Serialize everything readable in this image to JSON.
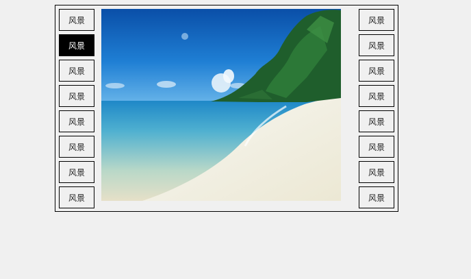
{
  "gallery": {
    "left_thumbs": [
      {
        "label": "风景",
        "active": false
      },
      {
        "label": "风景",
        "active": true
      },
      {
        "label": "风景",
        "active": false
      },
      {
        "label": "风景",
        "active": false
      },
      {
        "label": "风景",
        "active": false
      },
      {
        "label": "风景",
        "active": false
      },
      {
        "label": "风景",
        "active": false
      },
      {
        "label": "风景",
        "active": false
      }
    ],
    "right_thumbs": [
      {
        "label": "风景",
        "active": false
      },
      {
        "label": "风景",
        "active": false
      },
      {
        "label": "风景",
        "active": false
      },
      {
        "label": "风景",
        "active": false
      },
      {
        "label": "风景",
        "active": false
      },
      {
        "label": "风景",
        "active": false
      },
      {
        "label": "风景",
        "active": false
      },
      {
        "label": "风景",
        "active": false
      }
    ],
    "main_image": "tropical-beach-photo"
  },
  "colors": {
    "active_bg": "#000000",
    "active_fg": "#ffffff",
    "border": "#000000",
    "background": "#f0f0f0"
  }
}
